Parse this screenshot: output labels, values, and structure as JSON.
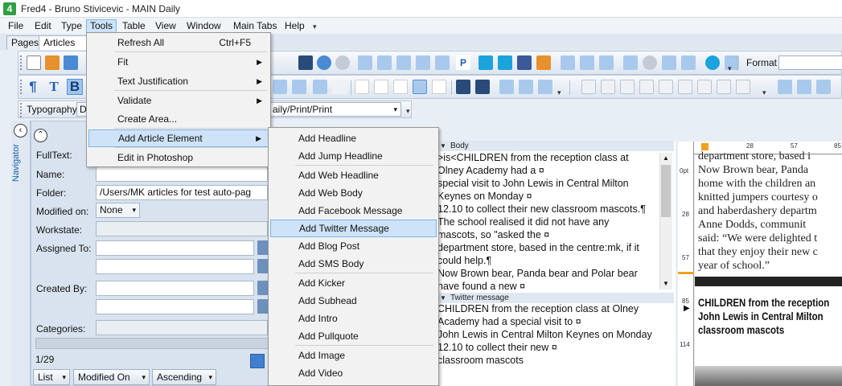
{
  "window": {
    "title": "Fred4 - Bruno Stivicevic - MAIN Daily",
    "app_icon": "4"
  },
  "menubar": {
    "items": [
      "File",
      "Edit",
      "Type",
      "Tools",
      "Table",
      "View",
      "Window",
      "Main Tabs",
      "Help"
    ],
    "active": "Tools"
  },
  "tabs": {
    "pages": "Pages",
    "articles": "Articles",
    "close": "×"
  },
  "toolbar": {
    "format_label": "Format",
    "typography_label": "Typography",
    "typography_value": "D",
    "style_value": "aily/Print/Print"
  },
  "navigator": {
    "label": "Navigator",
    "fields": {
      "fulltext": "FullText:",
      "name": "Name:",
      "folder": "Folder:",
      "folder_value": "/Users/MK articles for test auto-pag",
      "modified_on": "Modified on:",
      "modified_value": "None",
      "workstate": "Workstate:",
      "assigned_to": "Assigned To:",
      "created_by": "Created By:",
      "categories": "Categories:"
    },
    "count": "1/29",
    "view_mode": "List",
    "sort_field": "Modified On",
    "sort_order": "Ascending"
  },
  "tools_menu": {
    "items": [
      {
        "label": "Refresh All",
        "shortcut": "Ctrl+F5",
        "submenu": false
      },
      {
        "label": "Fit",
        "shortcut": "",
        "submenu": true
      },
      {
        "label": "Text Justification",
        "shortcut": "",
        "submenu": true
      },
      {
        "label": "Validate",
        "shortcut": "",
        "submenu": true
      },
      {
        "label": "Create Area...",
        "shortcut": "",
        "submenu": false
      },
      {
        "label": "Add Article Element",
        "shortcut": "",
        "submenu": true
      },
      {
        "label": "Edit in Photoshop",
        "shortcut": "",
        "submenu": false
      }
    ],
    "highlighted": "Add Article Element",
    "submenu_arrow": "▶"
  },
  "add_element_menu": {
    "items": [
      "Add Headline",
      "Add Jump Headline",
      "Add Web Headline",
      "Add Web Body",
      "Add Facebook Message",
      "Add Twitter Message",
      "Add Blog Post",
      "Add SMS Body",
      "Add Kicker",
      "Add Subhead",
      "Add Intro",
      "Add Pullquote",
      "Add Image",
      "Add Video"
    ],
    "highlighted": "Add Twitter Message"
  },
  "editor": {
    "body_header": "Body",
    "body_lines": [
      ">is<CHILDREN from the reception class at",
      "Olney Academy had a ¤",
      "special visit to John Lewis in Central Milton",
      "Keynes on Monday ¤",
      "12.10 to collect their new classroom mascots.¶",
      "The school realised it did not have any",
      "mascots, so \"asked the ¤",
      "department store, based in the centre:mk, if it",
      "could help.¶",
      "Now Brown bear, Panda bear and Polar bear",
      "have found a new ¤"
    ],
    "twitter_header": "Twitter message",
    "twitter_lines": [
      "CHILDREN from the reception class at Olney",
      "Academy had a special visit to ¤",
      "John Lewis in Central Milton Keynes on Monday",
      "12.10 to collect their new ¤",
      "classroom mascots"
    ]
  },
  "preview": {
    "ruler_top": [
      "28",
      "57",
      "85"
    ],
    "ruler_left": [
      "0pt",
      "28",
      "57",
      "85",
      "114"
    ],
    "body_lines": [
      "department store, based i",
      "   Now Brown bear, Panda",
      "home with the children an",
      "knitted jumpers courtesy o",
      "and haberdashery departm",
      "   Anne Dodds, communit",
      "said: “We were delighted t",
      "that they enjoy their new c",
      "year of school.”"
    ],
    "headline_lines": [
      "CHILDREN from the reception",
      "John Lewis in Central Milton",
      "classroom mascots"
    ]
  }
}
